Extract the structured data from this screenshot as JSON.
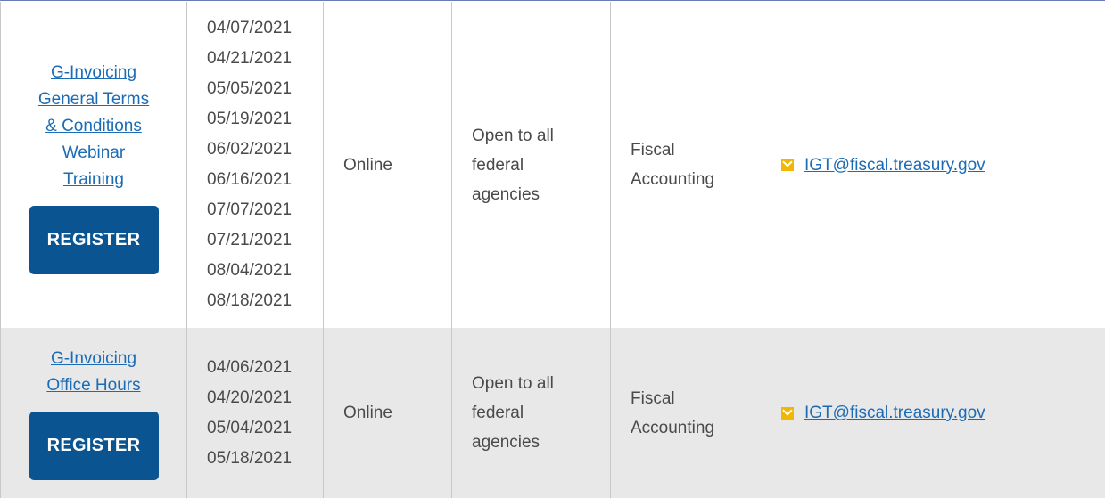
{
  "rows": [
    {
      "title_lines": [
        "G-Invoicing",
        "General Terms",
        "& Conditions",
        "Webinar",
        "Training"
      ],
      "register_label": "REGISTER",
      "dates": [
        "04/07/2021",
        "04/21/2021",
        "05/05/2021",
        "05/19/2021",
        "06/02/2021",
        "06/16/2021",
        "07/07/2021",
        "07/21/2021",
        "08/04/2021",
        "08/18/2021"
      ],
      "location": "Online",
      "audience_lines": [
        "Open to all",
        "federal",
        "agencies"
      ],
      "department_lines": [
        "Fiscal",
        "Accounting"
      ],
      "contact_icon": "mail-icon",
      "contact_email": "IGT@fiscal.treasury.gov"
    },
    {
      "title_lines": [
        "G-Invoicing",
        "Office Hours"
      ],
      "register_label": "REGISTER",
      "dates": [
        "04/06/2021",
        "04/20/2021",
        "05/04/2021",
        "05/18/2021"
      ],
      "location": "Online",
      "audience_lines": [
        "Open to all",
        "federal",
        "agencies"
      ],
      "department_lines": [
        "Fiscal",
        "Accounting"
      ],
      "contact_icon": "mail-icon",
      "contact_email": "IGT@fiscal.treasury.gov"
    }
  ],
  "colors": {
    "link": "#1c6cb5",
    "button": "#0a5591",
    "row_alt": "#e8e8e8",
    "icon": "#f2b705"
  }
}
